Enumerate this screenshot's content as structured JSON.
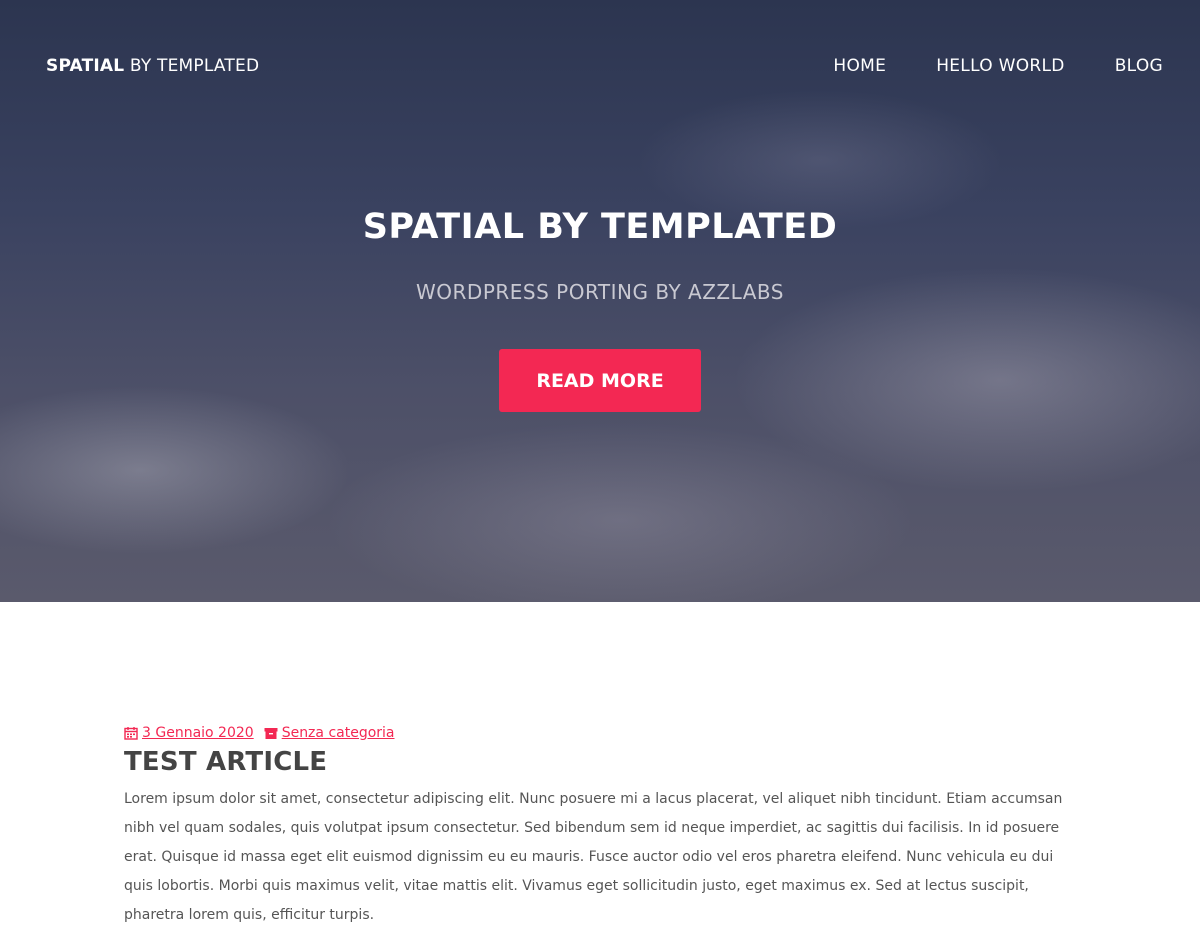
{
  "header": {
    "brand_bold": "SPATIAL",
    "brand_rest": " BY TEMPLATED",
    "nav": [
      {
        "label": "HOME"
      },
      {
        "label": "HELLO WORLD"
      },
      {
        "label": "BLOG"
      }
    ]
  },
  "hero": {
    "title": "SPATIAL BY TEMPLATED",
    "subtitle": "WORDPRESS PORTING BY AZZLABS",
    "cta_label": "READ MORE"
  },
  "colors": {
    "accent": "#f32853",
    "hero_overlay": "#2c3550"
  },
  "article": {
    "date": "3 Gennaio 2020",
    "date_icon": "calendar-icon",
    "category": "Senza categoria",
    "category_icon": "archive-icon",
    "title": "TEST ARTICLE",
    "body": "Lorem ipsum dolor sit amet, consectetur adipiscing elit. Nunc posuere mi a lacus placerat, vel aliquet nibh tincidunt. Etiam accumsan nibh vel quam sodales, quis volutpat ipsum consectetur. Sed bibendum sem id neque imperdiet, ac sagittis dui facilisis. In id posuere erat. Quisque id massa eget elit euismod dignissim eu eu mauris. Fusce auctor odio vel eros pharetra eleifend. Nunc vehicula eu dui quis lobortis. Morbi quis maximus velit, vitae mattis elit. Vivamus eget sollicitudin justo, eget maximus ex. Sed at lectus suscipit, pharetra lorem quis, efficitur turpis."
  }
}
